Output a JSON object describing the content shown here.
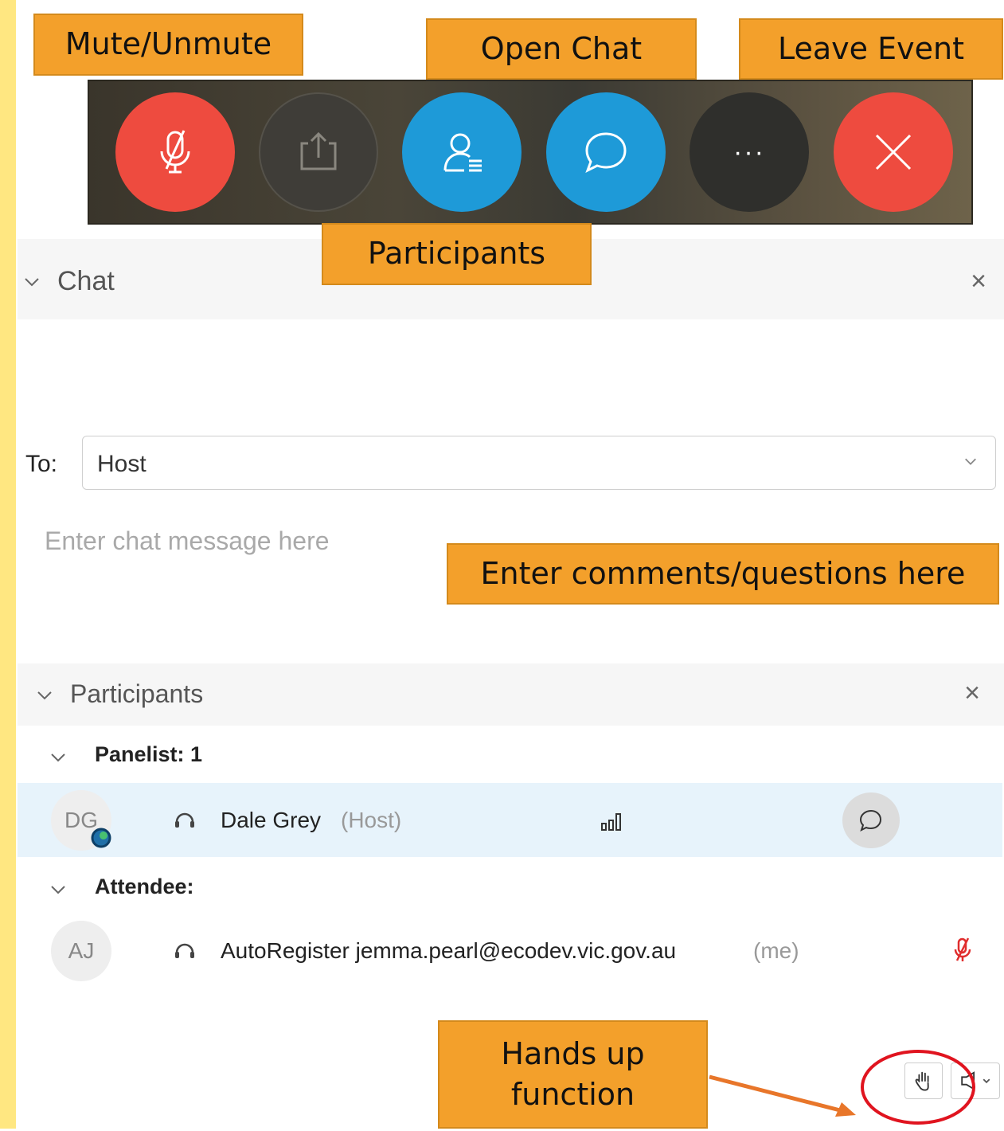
{
  "callouts": {
    "mute": "Mute/Unmute",
    "open_chat": "Open Chat",
    "leave_event": "Leave Event",
    "participants": "Participants",
    "enter_comments": "Enter comments/questions here",
    "hands_up_line1": "Hands up",
    "hands_up_line2": "function"
  },
  "toolbar": {
    "buttons": [
      "mic-muted-icon",
      "share-icon",
      "participants-icon",
      "chat-icon",
      "more-icon",
      "leave-icon"
    ],
    "more_label": "···",
    "colors": {
      "mute": "#ee4b3f",
      "share": "#3f3d38",
      "participants": "#1e9ad8",
      "chat": "#1e9ad8",
      "more": "#2f2f2c",
      "leave": "#ee4b3f"
    }
  },
  "chat": {
    "title": "Chat",
    "close": "×",
    "to_label": "To:",
    "to_value": "Host",
    "placeholder": "Enter chat message here"
  },
  "participants": {
    "title": "Participants",
    "close": "×",
    "panelist_group": "Panelist: 1",
    "attendee_group": "Attendee:",
    "panelist": {
      "initials": "DG",
      "name": "Dale Grey",
      "role": "(Host)"
    },
    "attendee": {
      "initials": "AJ",
      "name": "AutoRegister jemma.pearl@ecodev.vic.gov.au",
      "role": "(me)"
    }
  },
  "colors": {
    "callout": "#f3a02b",
    "highlight_row": "#e7f3fb",
    "annotation_red": "#e0141f",
    "arrow": "#e8762a"
  }
}
